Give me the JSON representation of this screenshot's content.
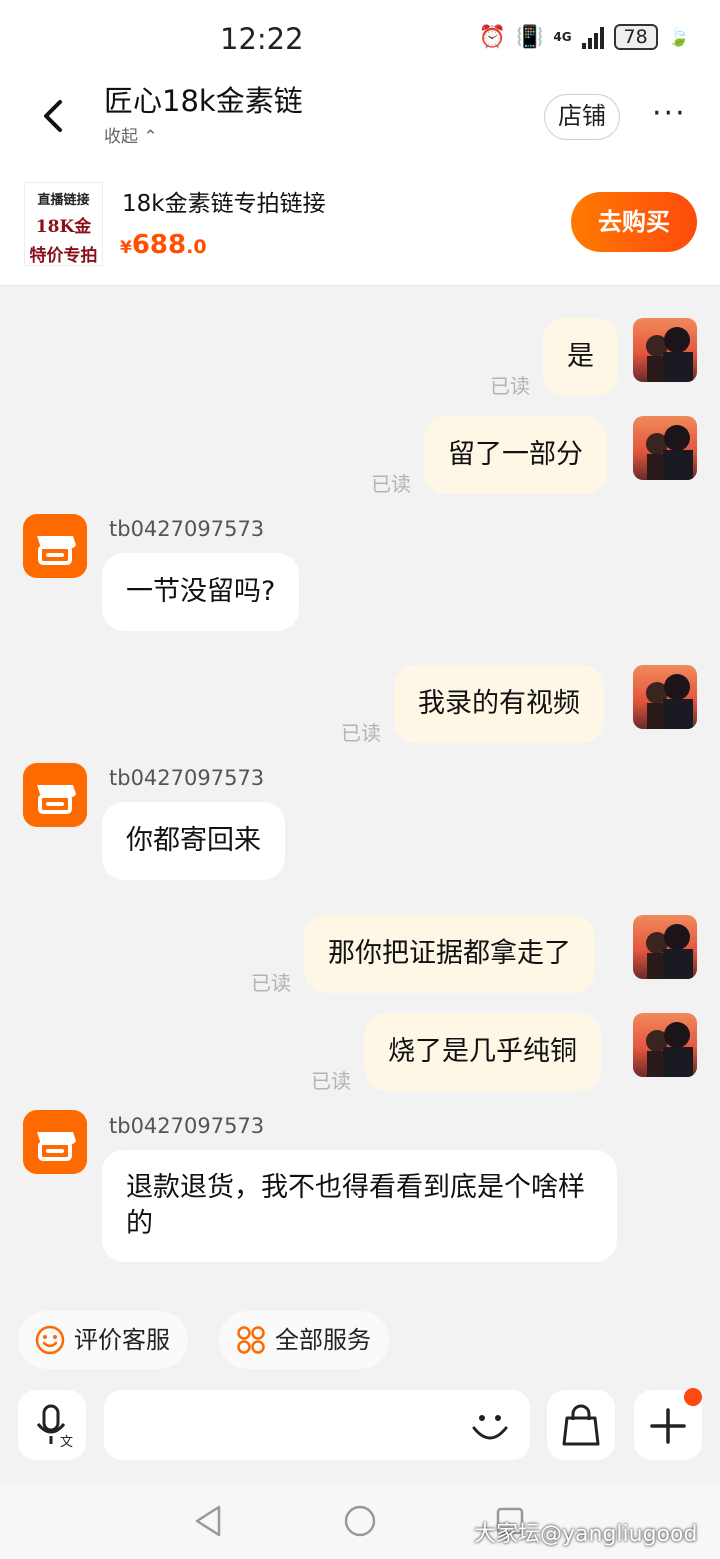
{
  "status_bar": {
    "time": "12:22",
    "network": "4G",
    "battery": "78"
  },
  "header": {
    "title": "匠心18k金素链",
    "collapse_label": "收起",
    "store_button": "店铺",
    "more_label": "···"
  },
  "product": {
    "thumb_line1": "直播链接",
    "thumb_line2": "18K金",
    "thumb_line3": "特价专拍",
    "title": "18k金素链专拍链接",
    "price_currency": "¥",
    "price_integer": "688",
    "price_decimal": ".0",
    "buy_button": "去购买"
  },
  "messages": [
    {
      "from": "me",
      "text": "是",
      "status": "已读"
    },
    {
      "from": "me",
      "text": "留了一部分",
      "status": "已读"
    },
    {
      "from": "shop",
      "sender": "tb0427097573",
      "text": "一节没留吗?"
    },
    {
      "from": "me",
      "text": "我录的有视频",
      "status": "已读"
    },
    {
      "from": "shop",
      "sender": "tb0427097573",
      "text": "你都寄回来"
    },
    {
      "from": "me",
      "text": "那你把证据都拿走了",
      "status": "已读"
    },
    {
      "from": "me",
      "text": "烧了是几乎纯铜",
      "status": "已读"
    },
    {
      "from": "shop",
      "sender": "tb0427097573",
      "text": "退款退货，我不也得看看到底是个啥样的"
    }
  ],
  "quick_actions": [
    {
      "label": "评价客服",
      "icon": "smiley-icon"
    },
    {
      "label": "全部服务",
      "icon": "grid-icon"
    }
  ],
  "input_bar": {
    "placeholder": ""
  },
  "watermark": "大家坛@yangliugood",
  "colors": {
    "accent": "#ff5000",
    "my_bubble": "#fff7e6",
    "background": "#f2f2f2"
  }
}
